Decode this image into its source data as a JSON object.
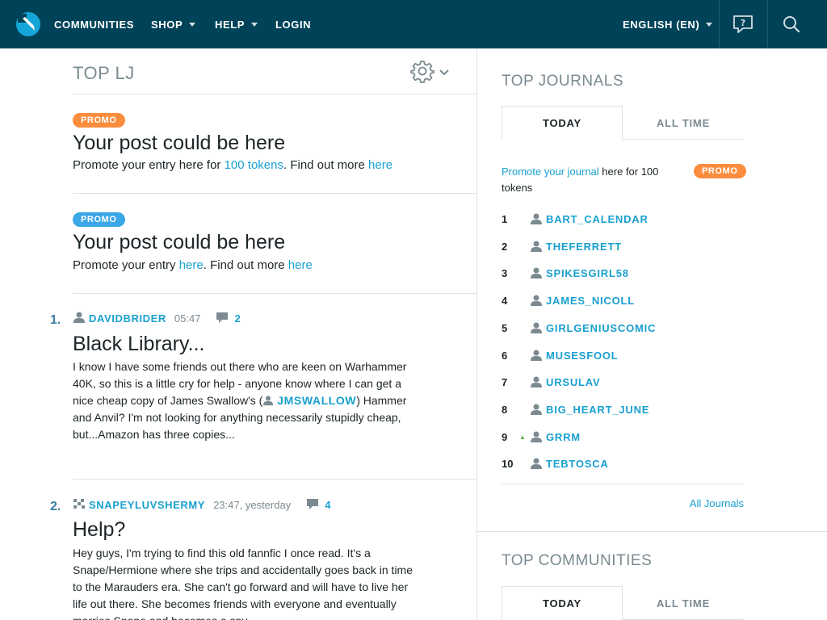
{
  "nav": {
    "items": [
      {
        "label": "COMMUNITIES",
        "has_caret": false
      },
      {
        "label": "SHOP",
        "has_caret": true
      },
      {
        "label": "HELP",
        "has_caret": true
      },
      {
        "label": "LOGIN",
        "has_caret": false
      }
    ],
    "language": "ENGLISH (EN)",
    "icons": [
      "help-bubble-icon",
      "search-icon"
    ]
  },
  "main": {
    "title": "TOP LJ",
    "promos": [
      {
        "badge": "PROMO",
        "title": "Your post could be here",
        "text_a": "Promote your entry here for ",
        "link_a": "100 tokens",
        "text_b": ". Find out more ",
        "link_b": "here"
      },
      {
        "badge": "PROMO",
        "title": "Your post could be here",
        "text_a": "Promote your entry ",
        "link_a": "here",
        "text_b": ". Find out more ",
        "link_b": "here"
      }
    ],
    "posts": [
      {
        "rank": "1.",
        "author": "DAVIDBRIDER",
        "time": "05:47",
        "comments": "2",
        "title": "Black Library...",
        "body_a": "I know I have some friends out there who are keen on Warhammer 40K, so this is a little cry for help - anyone know where I can get a nice cheap copy of James Swallow's (",
        "body_user": "JMSWALLOW",
        "body_b": ") Hammer and Anvil? I'm not looking for anything necessarily stupidly cheap, but...Amazon has three copies..."
      },
      {
        "rank": "2.",
        "author": "SNAPEYLUVSHERMY",
        "time": "23:47, yesterday",
        "comments": "4",
        "title": "Help?",
        "body": "Hey guys, I'm trying to find this old fannfic I once read. It's a Snape/Hermione where she trips and accidentally goes back in time to the Marauders era. She can't go forward and will have to live her life out there. She becomes friends with everyone and eventually marries Snape and becomes a spy..."
      }
    ]
  },
  "sidebar": {
    "journals_title": "TOP JOURNALS",
    "tabs": {
      "today": "TODAY",
      "all_time": "ALL TIME"
    },
    "promo_link": "Promote your journal",
    "promo_text": " here for 100 tokens",
    "promo_badge": "PROMO",
    "journals": [
      {
        "rank": "1",
        "name": "BART_CALENDAR",
        "up": false
      },
      {
        "rank": "2",
        "name": "THEFERRETT",
        "up": false
      },
      {
        "rank": "3",
        "name": "SPIKESGIRL58",
        "up": false
      },
      {
        "rank": "4",
        "name": "JAMES_NICOLL",
        "up": false
      },
      {
        "rank": "5",
        "name": "GIRLGENIUSCOMIC",
        "up": false
      },
      {
        "rank": "6",
        "name": "MUSESFOOL",
        "up": false
      },
      {
        "rank": "7",
        "name": "URSULAV",
        "up": false
      },
      {
        "rank": "8",
        "name": "BIG_HEART_JUNE",
        "up": false
      },
      {
        "rank": "9",
        "name": "GRRM",
        "up": true
      },
      {
        "rank": "10",
        "name": "TEBTOSCA",
        "up": false
      }
    ],
    "all_journals": "All Journals",
    "communities_title": "TOP COMMUNITIES",
    "communities_tabs": {
      "today": "TODAY",
      "all_time": "ALL TIME"
    }
  },
  "colors": {
    "nav_bg": "#004359",
    "link": "#19a0d0",
    "promo_orange": "#fb8d3d",
    "promo_blue": "#3aa7e6"
  }
}
